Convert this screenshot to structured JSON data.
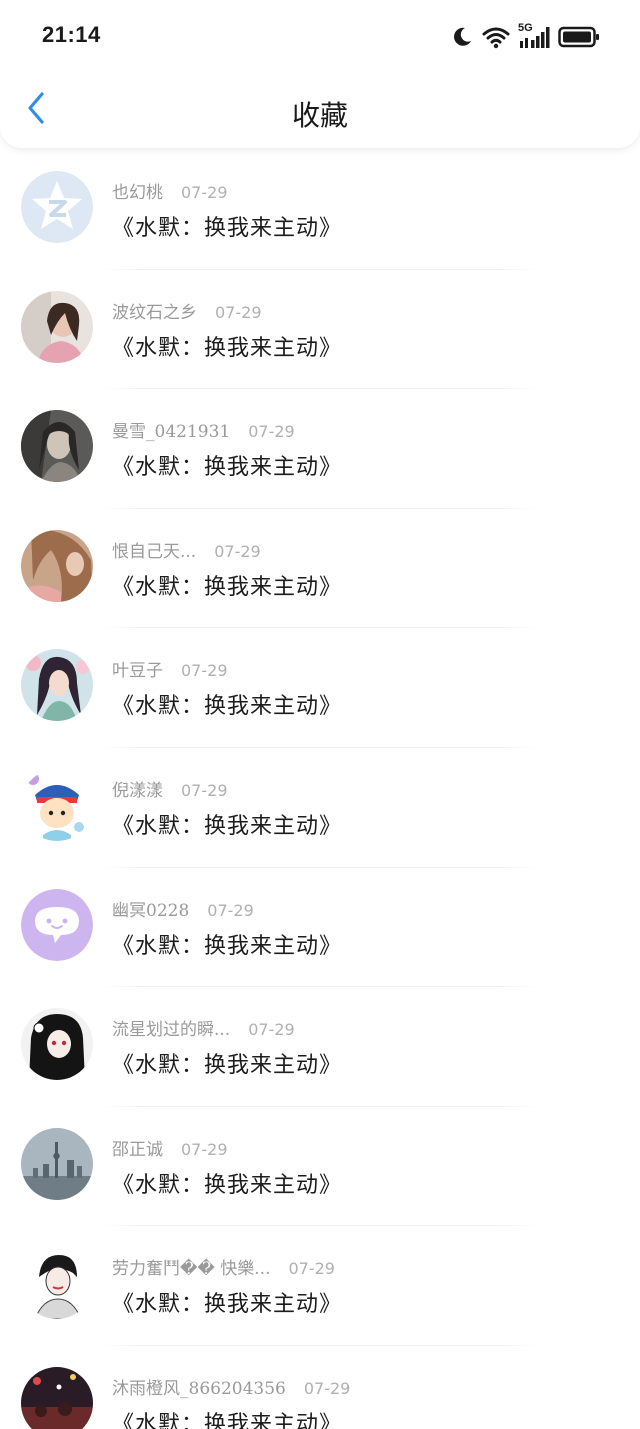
{
  "status_bar": {
    "time": "21:14",
    "network_label": "5G",
    "icons": [
      "moon-icon",
      "wifi-icon",
      "signal-icon",
      "battery-icon"
    ]
  },
  "nav": {
    "title": "收藏",
    "back_icon": "chevron-left-icon",
    "accent_color": "#2f8fe8"
  },
  "items": [
    {
      "name": "也幻桃",
      "date": "07-29",
      "title": "《水默：换我来主动》",
      "avatar": "qq-star-default"
    },
    {
      "name": "波纹石之乡",
      "date": "07-29",
      "title": "《水默：换我来主动》",
      "avatar": "photo-woman"
    },
    {
      "name": "曼雪_0421931",
      "date": "07-29",
      "title": "《水默：换我来主动》",
      "avatar": "photo-dark-art"
    },
    {
      "name": "恨自己天...",
      "date": "07-29",
      "title": "《水默：换我来主动》",
      "avatar": "photo-hair"
    },
    {
      "name": "叶豆子",
      "date": "07-29",
      "title": "《水默：换我来主动》",
      "avatar": "photo-anime-girl"
    },
    {
      "name": "倪漾漾",
      "date": "07-29",
      "title": "《水默：换我来主动》",
      "avatar": "cartoon-boy"
    },
    {
      "name": "幽冥0228",
      "date": "07-29",
      "title": "《水默：换我来主动》",
      "avatar": "chat-bubble-default"
    },
    {
      "name": "流星划过的瞬...",
      "date": "07-29",
      "title": "《水默：换我来主动》",
      "avatar": "photo-gothic-girl"
    },
    {
      "name": "邵正诚",
      "date": "07-29",
      "title": "《水默：换我来主动》",
      "avatar": "photo-city-skyline"
    },
    {
      "name": "劳力奮鬥�� 快樂...",
      "date": "07-29",
      "title": "《水默：换我来主动》",
      "avatar": "sketch-girl"
    },
    {
      "name": "沐雨橙风_866204356",
      "date": "07-29",
      "title": "《水默：换我来主动》",
      "avatar": "photo-night-crowd"
    }
  ]
}
